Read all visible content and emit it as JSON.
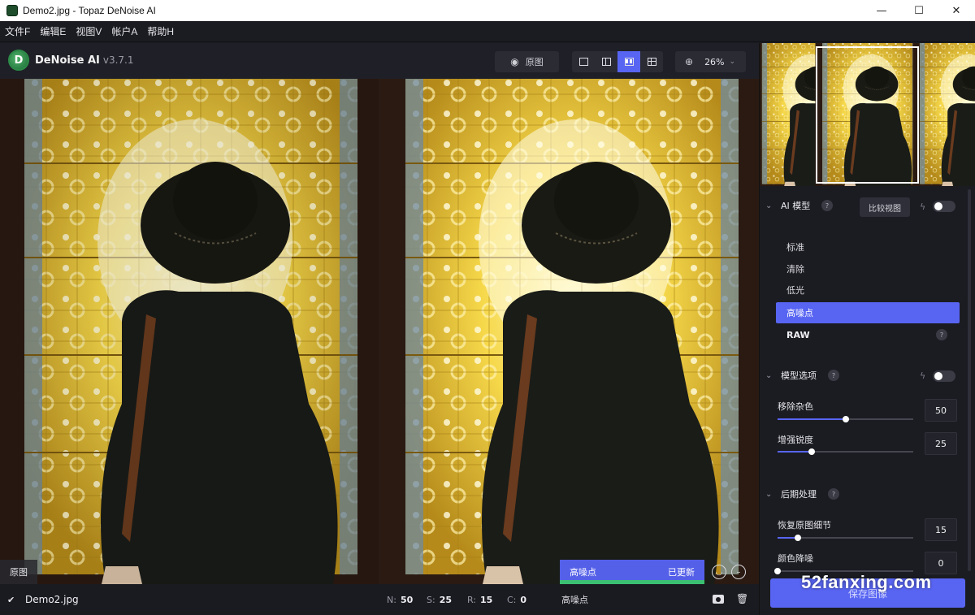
{
  "window": {
    "title": "Demo2.jpg - Topaz DeNoise AI",
    "controls": {
      "minimize": "—",
      "maximize": "☐",
      "close": "✕"
    }
  },
  "menu": [
    "文件F",
    "编辑E",
    "视图V",
    "帐户A",
    "帮助H"
  ],
  "toolbar": {
    "logo_text": "DeNoise AI",
    "version": "v3.7.1",
    "original_label": "原图",
    "zoom": "26%",
    "active_view": "side-by-side"
  },
  "panes": {
    "left_label": "原图",
    "model_banner_name": "高噪点",
    "model_banner_status": "已更新"
  },
  "status": {
    "filename": "Demo2.jpg",
    "stats": [
      {
        "key": "N:",
        "value": "50"
      },
      {
        "key": "S:",
        "value": "25"
      },
      {
        "key": "R:",
        "value": "15"
      },
      {
        "key": "C:",
        "value": "0"
      }
    ],
    "model": "高噪点"
  },
  "panel": {
    "ai_model": {
      "title": "AI 模型",
      "compare_btn": "比较视图",
      "items": [
        {
          "label": "标准"
        },
        {
          "label": "清除"
        },
        {
          "label": "低光"
        },
        {
          "label": "高噪点"
        },
        {
          "label": "RAW"
        }
      ],
      "active_item": "高噪点"
    },
    "model_options": {
      "title": "模型选项",
      "sliders": [
        {
          "label": "移除杂色",
          "value": "50",
          "fraction": 0.5
        },
        {
          "label": "增强锐度",
          "value": "25",
          "fraction": 0.25
        }
      ]
    },
    "post_processing": {
      "title": "后期处理",
      "sliders": [
        {
          "label": "恢复原图细节",
          "value": "15",
          "fraction": 0.15
        },
        {
          "label": "颜色降噪",
          "value": "0",
          "fraction": 0.0
        }
      ]
    },
    "save_button": "保存图像"
  },
  "watermark": "52fanxing.com",
  "colors": {
    "accent": "#5865f2",
    "progress": "#3bbf72",
    "background": "#1b1c22"
  }
}
